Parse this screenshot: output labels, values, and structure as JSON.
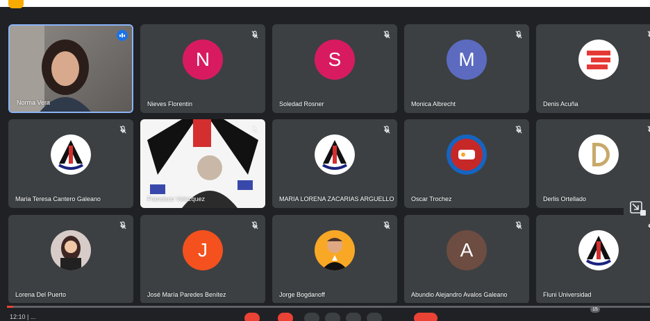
{
  "meeting": {
    "clock": "12:10 | ...",
    "participant_count": "15",
    "progress": 0.01
  },
  "participants": [
    {
      "name": "Norma Vera",
      "type": "video",
      "speaking": true
    },
    {
      "name": "Nieves Florentin",
      "type": "initial",
      "initial": "N",
      "color": "#d81b60",
      "muted": true
    },
    {
      "name": "Soledad Rosner",
      "type": "initial",
      "initial": "S",
      "color": "#d81b60",
      "muted": true
    },
    {
      "name": "Monica Albrecht",
      "type": "initial",
      "initial": "M",
      "color": "#5c6bc0",
      "muted": true
    },
    {
      "name": "Denis Acuña",
      "type": "logo",
      "logo": "red-stripes-logo",
      "muted": true
    },
    {
      "name": "Maria Teresa Cantero Galeano",
      "type": "logo",
      "logo": "university-emblem",
      "muted": true
    },
    {
      "name": "Francisco Velazquez",
      "type": "video",
      "muted": true
    },
    {
      "name": "MARIA LORENA ZACARIAS ARGUELLO",
      "type": "logo",
      "logo": "university-emblem",
      "muted": true
    },
    {
      "name": "Oscar Trochez",
      "type": "logo",
      "logo": "round-badge-logo",
      "muted": true
    },
    {
      "name": "Derlis Ortellado",
      "type": "logo",
      "logo": "gold-d-logo",
      "muted": true
    },
    {
      "name": "Lorena Del Puerto",
      "type": "photo",
      "photo": "woman-photo",
      "muted": true
    },
    {
      "name": "José María Paredes Benítez",
      "type": "initial",
      "initial": "J",
      "color": "#f4511e",
      "muted": true
    },
    {
      "name": "Jorge Bogdanoff",
      "type": "photo",
      "photo": "man-photo",
      "muted": true
    },
    {
      "name": "Abundio Alejandro Avalos Galeano",
      "type": "initial",
      "initial": "A",
      "color": "#6d4c41",
      "muted": true
    },
    {
      "name": "Fluni Universidad",
      "type": "logo",
      "logo": "university-emblem",
      "muted": true
    }
  ],
  "colors": {
    "background": "#202124",
    "tile": "#3c4043",
    "active_border": "#8ab4f8",
    "leave_red": "#ea4335"
  }
}
